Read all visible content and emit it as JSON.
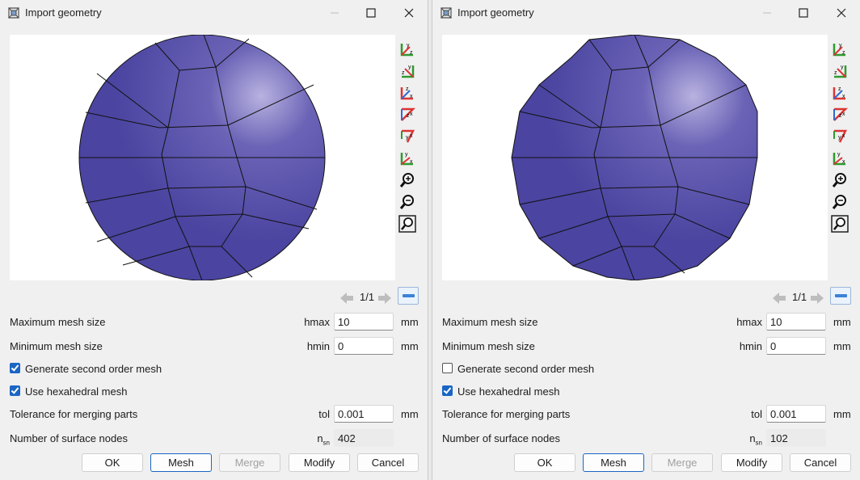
{
  "dialogs": [
    {
      "title": "Import geometry",
      "pager": "1/1",
      "max_mesh": {
        "label": "Maximum mesh size",
        "symbol": "hmax",
        "value": "10",
        "unit": "mm"
      },
      "min_mesh": {
        "label": "Minimum mesh size",
        "symbol": "hmin",
        "value": "0",
        "unit": "mm"
      },
      "second_order": {
        "label": "Generate second order mesh",
        "checked": true
      },
      "hexahedral": {
        "label": "Use hexahedral mesh",
        "checked": true
      },
      "tolerance": {
        "label": "Tolerance for merging parts",
        "symbol": "tol",
        "value": "0.001",
        "unit": "mm"
      },
      "surface_nodes": {
        "label": "Number of surface nodes",
        "symbol": "n",
        "symbol_sub": "sn",
        "value": "402"
      },
      "buttons": {
        "ok": "OK",
        "mesh": "Mesh",
        "merge": "Merge",
        "modify": "Modify",
        "cancel": "Cancel"
      }
    },
    {
      "title": "Import geometry",
      "pager": "1/1",
      "max_mesh": {
        "label": "Maximum mesh size",
        "symbol": "hmax",
        "value": "10",
        "unit": "mm"
      },
      "min_mesh": {
        "label": "Minimum mesh size",
        "symbol": "hmin",
        "value": "0",
        "unit": "mm"
      },
      "second_order": {
        "label": "Generate second order mesh",
        "checked": false
      },
      "hexahedral": {
        "label": "Use hexahedral mesh",
        "checked": true
      },
      "tolerance": {
        "label": "Tolerance for merging parts",
        "symbol": "tol",
        "value": "0.001",
        "unit": "mm"
      },
      "surface_nodes": {
        "label": "Number of surface nodes",
        "symbol": "n",
        "symbol_sub": "sn",
        "value": "102"
      },
      "buttons": {
        "ok": "OK",
        "mesh": "Mesh",
        "merge": "Merge",
        "modify": "Modify",
        "cancel": "Cancel"
      }
    }
  ],
  "view_tools": [
    {
      "name": "view-yz-icon",
      "a": "y",
      "b": "z"
    },
    {
      "name": "view-zy-icon",
      "a": "z",
      "b": "y"
    },
    {
      "name": "view-zx-icon",
      "a": "z",
      "b": "x"
    },
    {
      "name": "view-xz-icon",
      "a": "z",
      "b": "x"
    },
    {
      "name": "view-yx-icon",
      "a": "y",
      "b": "x"
    },
    {
      "name": "view-xy-icon",
      "a": "y",
      "b": "x"
    }
  ],
  "colors": {
    "mesh_fill": "#4b44a0",
    "mesh_highlight": "#b8b2e0",
    "accent": "#1a66c4"
  }
}
